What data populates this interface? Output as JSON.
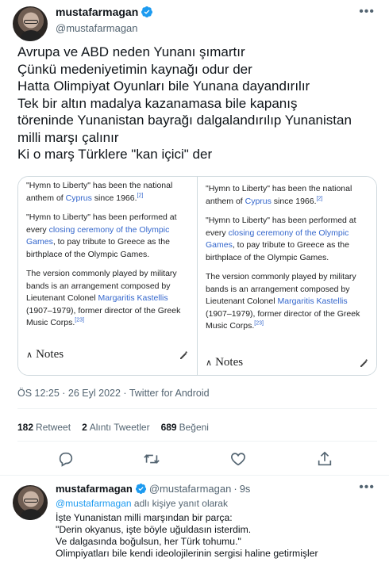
{
  "tweet": {
    "display_name": "mustafarmagan",
    "handle": "@mustafarmagan",
    "more_icon": "more-horizontal-icon",
    "text_lines": [
      "Avrupa ve ABD neden Yunanı şımartır",
      "Çünkü medeniyetimin kaynağı odur der",
      "Hatta Olimpiyat Oyunları bile Yunana dayandırılır",
      "Tek bir altın madalya kazanamasa bile kapanış",
      "töreninde Yunanistan bayrağı dalgalandırılıp Yunanistan",
      "milli marşı çalınır",
      "Ki o marş Türklere \"kan içici\" der"
    ],
    "meta": "ÖS 12:25 · 26 Eyl 2022 · Twitter for Android",
    "stats": {
      "retweets_count": "182",
      "retweets_label": "Retweet",
      "quotes_count": "2",
      "quotes_label": "Alıntı Tweetler",
      "likes_count": "689",
      "likes_label": "Beğeni"
    },
    "verified_color": "#1d9bf0"
  },
  "media": {
    "panels": [
      {
        "p1_a": "\"Hymn to Liberty\" has been the national anthem of ",
        "p1_link": "Cyprus",
        "p1_b": " since 1966.",
        "p1_ref": "[2]",
        "p2_a": "\"Hymn to Liberty\" has been performed at every ",
        "p2_link": "closing ceremony of the Olympic Games",
        "p2_b": ", to pay tribute to Greece as the birthplace of the Olympic Games.",
        "p3_a": "The version commonly played by military bands is an arrangement composed by Lieutenant Colonel ",
        "p3_link": "Margaritis Kastellis",
        "p3_b": " (1907–1979), former director of the Greek Music Corps.",
        "p3_ref": "[23]",
        "notes_label": "Notes"
      },
      {
        "p1_a": "\"Hymn to Liberty\" has been the national anthem of ",
        "p1_link": "Cyprus",
        "p1_b": " since 1966.",
        "p1_ref": "[2]",
        "p2_a": "\"Hymn to Liberty\" has been performed at every ",
        "p2_link": "closing ceremony of the Olympic Games",
        "p2_b": ", to pay tribute to Greece as the birthplace of the Olympic Games.",
        "p3_a": "The version commonly played by military bands is an arrangement composed by Lieutenant Colonel ",
        "p3_link": "Margaritis Kastellis",
        "p3_b": " (1907–1979), former director of the Greek Music Corps.",
        "p3_ref": "[23]",
        "notes_label": "Notes"
      }
    ],
    "link_color": "#3366cc"
  },
  "actions": [
    "reply-icon",
    "retweet-icon",
    "like-icon",
    "share-icon"
  ],
  "reply": {
    "display_name": "mustafarmagan",
    "handle": "@mustafarmagan",
    "dot": "·",
    "time": "9s",
    "reply_to_link": "@mustafarmagan",
    "reply_to_suffix": " adlı kişiye yanıt olarak",
    "body_lines": [
      "İşte Yunanistan milli marşından bir parça:",
      "\"Derin okyanus, işte böyle uğuldasın isterdim.",
      "Ve dalgasında boğulsun, her Türk tohumu.\"",
      "Olimpiyatları bile kendi ideolojilerinin sergisi haline getirmişler"
    ],
    "more_icon": "more-horizontal-icon"
  }
}
